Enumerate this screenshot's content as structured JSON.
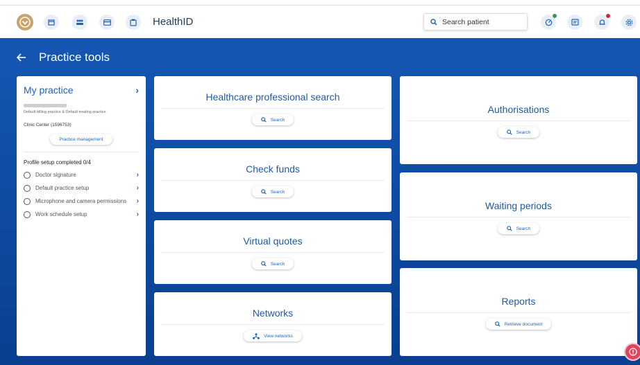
{
  "header": {
    "brand": "HealthID",
    "search_placeholder": "Search patient",
    "accent": "#1e63b5",
    "nav_icons": [
      "calendar-icon",
      "people-icon",
      "card-icon",
      "clipboard-icon"
    ],
    "right_icons": [
      "activity-icon",
      "messages-icon",
      "bell-icon",
      "settings-icon"
    ],
    "status_colors": {
      "online": "#2e9e4a",
      "alert": "#d9263b"
    }
  },
  "page": {
    "title": "Practice tools"
  },
  "practice": {
    "title": "My practice",
    "subtitle": "Default billing practice & Default treating practice",
    "clinic": "Clinic Center (1596753)",
    "management_label": "Practice management",
    "setup_progress": "Profile setup completed 0/4",
    "steps": [
      {
        "label": "Doctor signature"
      },
      {
        "label": "Default practice setup"
      },
      {
        "label": "Microphone and camera permissions"
      },
      {
        "label": "Work schedule setup"
      }
    ]
  },
  "tools": {
    "hcp": {
      "title": "Healthcare professional search",
      "button": "Search"
    },
    "funds": {
      "title": "Check funds",
      "button": "Search"
    },
    "quotes": {
      "title": "Virtual quotes",
      "button": "Search"
    },
    "networks": {
      "title": "Networks",
      "button": "View networks"
    },
    "auth": {
      "title": "Authorisations",
      "button": "Search"
    },
    "waiting": {
      "title": "Waiting periods",
      "button": "Search"
    },
    "reports": {
      "title": "Reports",
      "button": "Retrieve document"
    }
  }
}
